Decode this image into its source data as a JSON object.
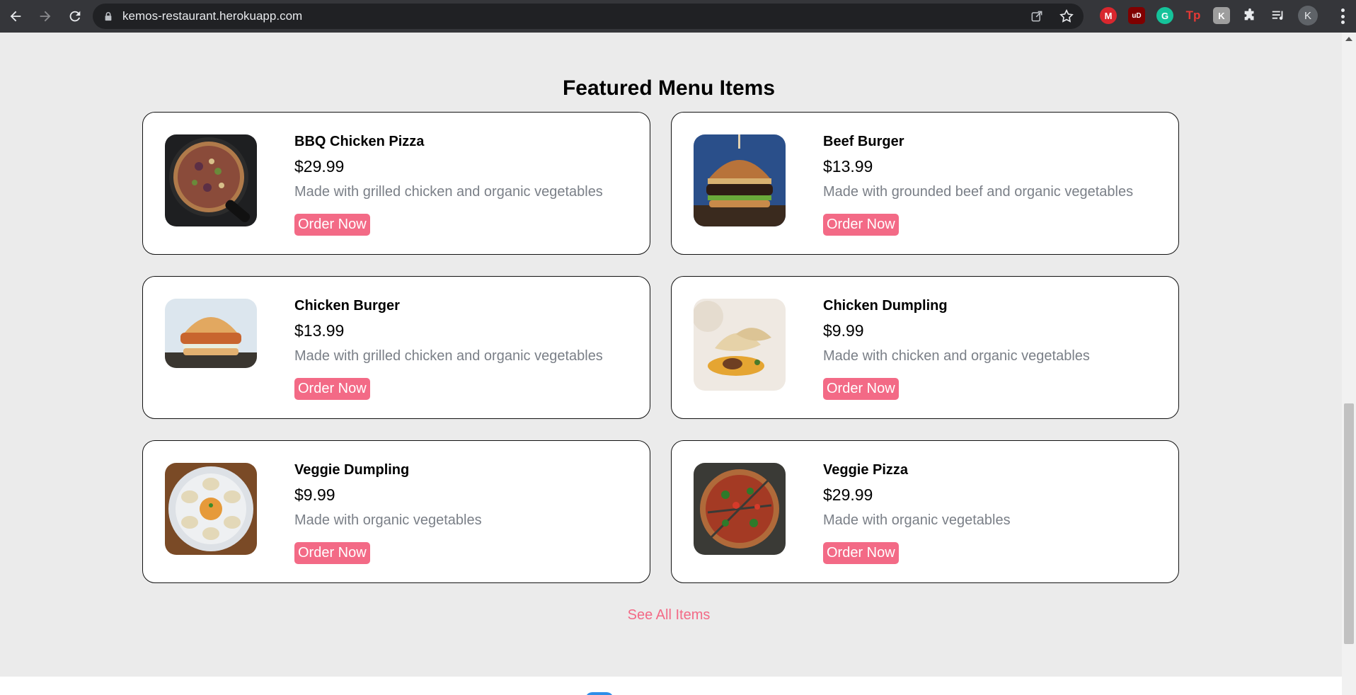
{
  "browser": {
    "url": "kemos-restaurant.herokuapp.com",
    "profile_initial": "K",
    "extensions": [
      {
        "name": "mega-icon",
        "label": "M",
        "color": "#d9272e"
      },
      {
        "name": "ublock-icon",
        "label": "uD",
        "color": "#800000"
      },
      {
        "name": "grammarly-icon",
        "label": "G",
        "color": "#15c39a"
      },
      {
        "name": "tp-icon",
        "label": "Tp",
        "color": "#e53935"
      },
      {
        "name": "kanji-icon",
        "label": "K",
        "color": "#9e9e9e"
      }
    ]
  },
  "section": {
    "title": "Featured Menu Items",
    "see_all": "See All Items"
  },
  "items": [
    {
      "name": "BBQ Chicken Pizza",
      "price": "$29.99",
      "description": "Made with grilled chicken and organic vegetables",
      "button": "Order Now"
    },
    {
      "name": "Beef Burger",
      "price": "$13.99",
      "description": "Made with grounded beef and organic vegetables",
      "button": "Order Now"
    },
    {
      "name": "Chicken Burger",
      "price": "$13.99",
      "description": "Made with grilled chicken and organic vegetables",
      "button": "Order Now"
    },
    {
      "name": "Chicken Dumpling",
      "price": "$9.99",
      "description": "Made with chicken and organic vegetables",
      "button": "Order Now"
    },
    {
      "name": "Veggie Dumpling",
      "price": "$9.99",
      "description": "Made with organic vegetables",
      "button": "Order Now"
    },
    {
      "name": "Veggie Pizza",
      "price": "$29.99",
      "description": "Made with organic vegetables",
      "button": "Order Now"
    }
  ],
  "colors": {
    "accent": "#f36a86",
    "page_background": "#ebebeb",
    "description_text": "#7a7f87"
  }
}
